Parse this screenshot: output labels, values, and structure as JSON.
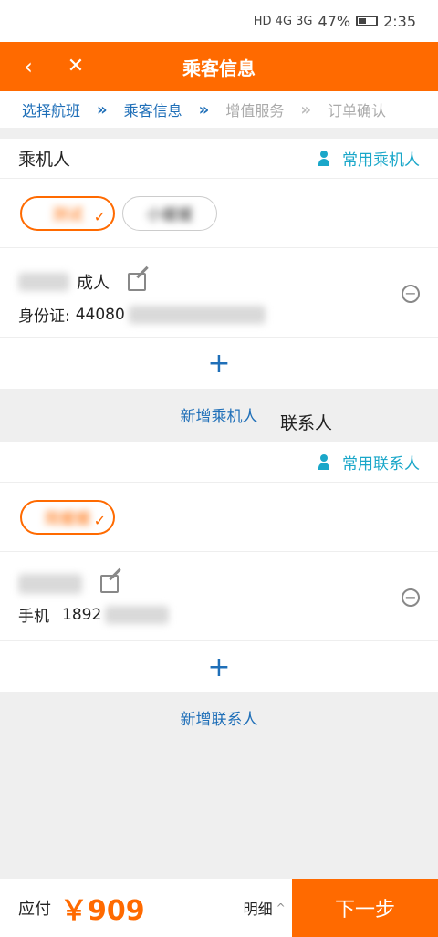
{
  "status_bar": {
    "left_icons": "HD 4G 3G",
    "battery": "47%",
    "time": "2:35"
  },
  "nav": {
    "title": "乘客信息",
    "back_icon": "‹",
    "close_icon": "✕"
  },
  "steps": [
    {
      "label": "选择航班",
      "active": true
    },
    {
      "label": "乘客信息",
      "active": true
    },
    {
      "label": "增值服务",
      "active": false
    },
    {
      "label": "订单确认",
      "active": false
    }
  ],
  "step_separator": "»",
  "passengers": {
    "section_title": "乘机人",
    "common_link": "常用乘机人",
    "chips": [
      "测试",
      "小媛媛"
    ],
    "person": {
      "type": "成人",
      "id_label": "身份证:",
      "id_value": "44080"
    },
    "add_label": "新增乘机人",
    "add_icon": "+",
    "minus_icon": "−"
  },
  "contacts": {
    "section_title": "联系人",
    "common_link": "常用联系人",
    "chips": [
      "简媛媛"
    ],
    "person": {
      "phone_label": "手机",
      "phone_value": "1892"
    },
    "add_label": "新增联系人",
    "add_icon": "+",
    "minus_icon": "−"
  },
  "bottom": {
    "pay_label": "应付",
    "price": "￥909",
    "detail": "明细",
    "detail_icon": "^",
    "next": "下一步"
  }
}
